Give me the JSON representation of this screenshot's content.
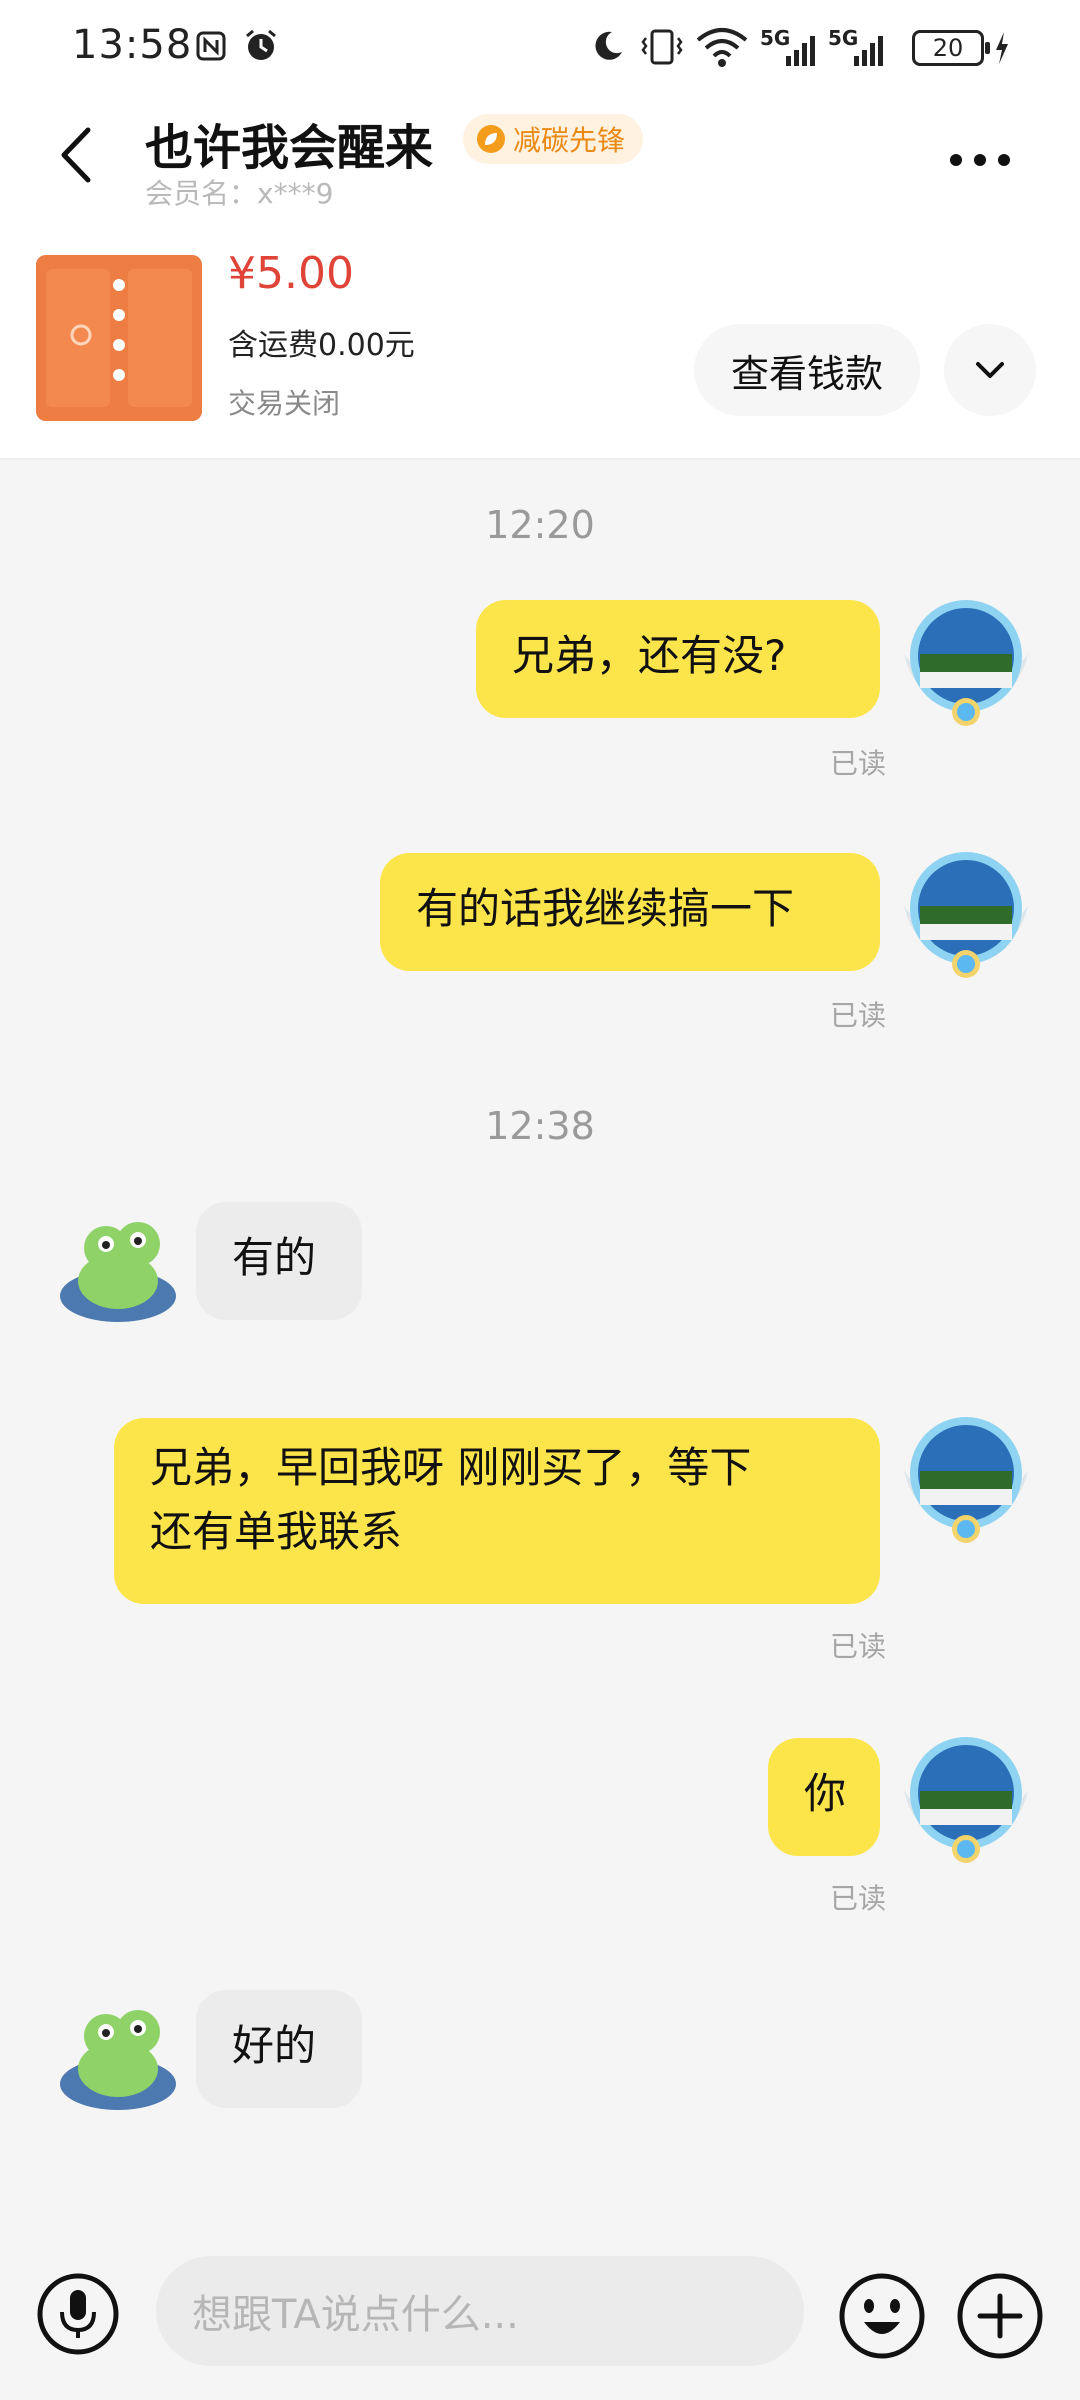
{
  "status_bar": {
    "time": "13:58",
    "battery": "20",
    "net_left": "5G",
    "net_right": "5G"
  },
  "header": {
    "title": "也许我会醒来",
    "badge": "减碳先锋",
    "member_label": "会员名：x***9"
  },
  "product": {
    "price": "¥5.00",
    "shipping": "含运费0.00元",
    "status": "交易关闭",
    "view_button": "查看钱款"
  },
  "chat": {
    "ts1": "12:20",
    "m1": "兄弟，还有没?",
    "r1": "已读",
    "m2": "有的话我继续搞一下",
    "r2": "已读",
    "ts2": "12:38",
    "m3": "有的",
    "m4_line1": "兄弟，早回我呀 刚刚买了，等下",
    "m4_line2": "还有单我联系",
    "r4": "已读",
    "m5": "你",
    "r5": "已读",
    "m6": "好的"
  },
  "input": {
    "placeholder": "想跟TA说点什么..."
  },
  "icons": {
    "accent": "#fce54b",
    "price_color": "#e04337"
  }
}
